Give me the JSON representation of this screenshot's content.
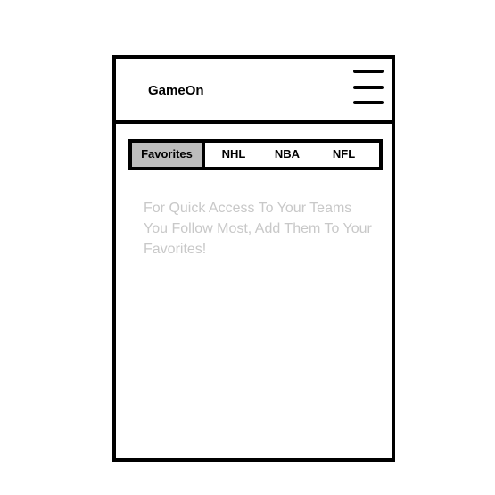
{
  "app": {
    "title": "GameOn"
  },
  "header": {
    "menu_icon": "hamburger-menu-icon"
  },
  "tabs": [
    {
      "label": "Favorites",
      "selected": true
    },
    {
      "label": "NHL",
      "selected": false
    },
    {
      "label": "NBA",
      "selected": false
    },
    {
      "label": "NFL",
      "selected": false
    }
  ],
  "favorites": {
    "empty_message": "For Quick Access To Your Teams You Follow Most, Add Them To Your Favorites!"
  },
  "colors": {
    "selected_tab_bg": "#bdbdbd",
    "border": "#000000",
    "placeholder_text": "#c8c8c8"
  }
}
